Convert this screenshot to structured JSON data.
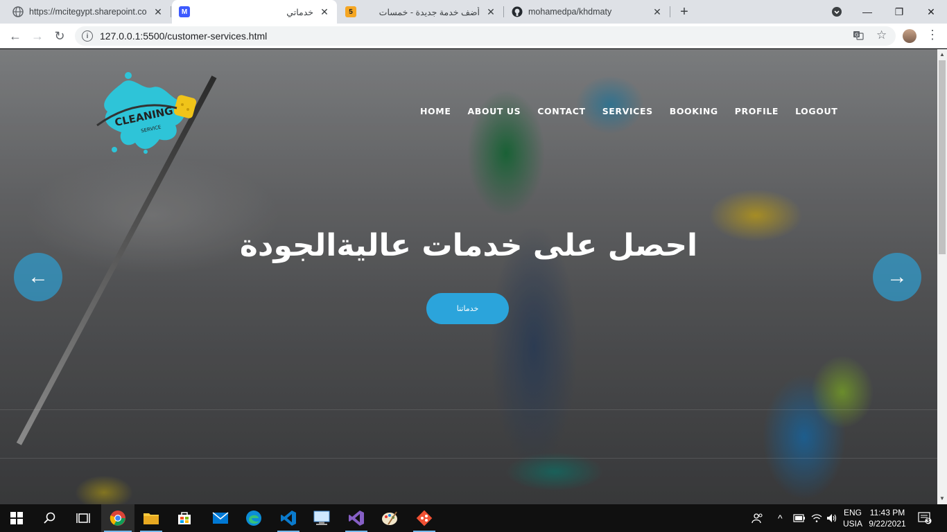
{
  "browser": {
    "tabs": [
      {
        "title": "https://mcitegypt.sharepoint.com",
        "icon": "globe-icon",
        "active": false
      },
      {
        "title": "خدماتي",
        "icon": "m-plus-icon",
        "active": true
      },
      {
        "title": "أضف خدمة جديدة - خمسات",
        "icon": "khamsat-5-icon",
        "active": false
      },
      {
        "title": "mohamedpa/khdmaty",
        "icon": "github-icon",
        "active": false
      }
    ],
    "favicon_text_khamsat": "5",
    "url": "127.0.0.1:5500/customer-services.html"
  },
  "site": {
    "logo_text": "CLEANING",
    "logo_subtext": "SERVICE",
    "nav": [
      "HOME",
      "ABOUT US",
      "CONTACT",
      "SERVICES",
      "BOOKING",
      "PROFILE",
      "LOGOUT"
    ],
    "headline": "احصل على خدمات عاليةالجودة",
    "cta_label": "خدماتنا",
    "prev_arrow": "←",
    "next_arrow": "→"
  },
  "taskbar": {
    "apps": [
      "start",
      "search",
      "task-view",
      "chrome",
      "file-explorer",
      "store",
      "mail",
      "edge",
      "vscode",
      "remote-desktop",
      "visual-studio",
      "paint",
      "git"
    ],
    "lang_top": "ENG",
    "lang_bottom": "USIA",
    "time": "11:43 PM",
    "date": "9/22/2021",
    "notifications": "3"
  },
  "colors": {
    "accent": "#2ba4db",
    "tabstrip": "#dee1e6",
    "taskbar": "#101010"
  }
}
